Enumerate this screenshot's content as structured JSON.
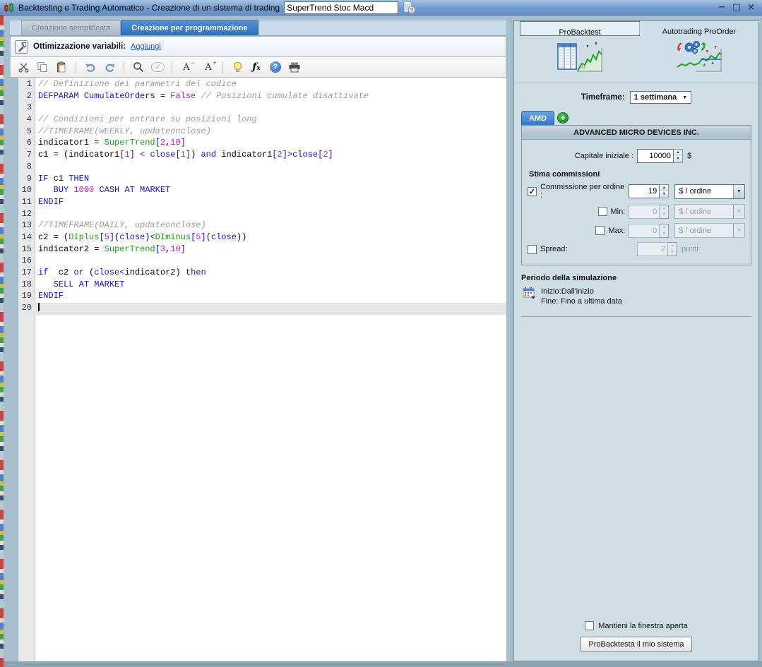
{
  "window": {
    "title": "Backtesting e Trading Automatico - Creazione di un sistema di trading",
    "system_name": "SuperTrend Stoc Macd",
    "controls": {
      "minimize": "−",
      "maximize": "□",
      "close": "×"
    }
  },
  "tabs": [
    {
      "label": "Creazione semplificata"
    },
    {
      "label": "Creazione per programmazione"
    }
  ],
  "optimization": {
    "label": "Ottimizzazione variabili:",
    "link": "Aggiungi"
  },
  "toolbar": {
    "icons": [
      "cut-icon",
      "copy-icon",
      "paste-icon",
      "undo-icon",
      "redo-icon",
      "search-icon",
      "toggle-comment-icon",
      "font-smaller-icon",
      "font-larger-icon",
      "hint-bulb-icon",
      "insert-function-icon",
      "help-icon",
      "print-icon"
    ],
    "comment_glyph": "//",
    "font_a": "A",
    "minus": "−",
    "plus": "+",
    "fx": "ƒ",
    "fx_x": "x",
    "help_q": "?"
  },
  "icons": {
    "check": "✓",
    "dropdown": "▼",
    "spin_up": "▲",
    "spin_down": "▼",
    "plus": "+",
    "help_q": "?"
  },
  "editor": {
    "lines": [
      {
        "n": 1,
        "tokens": [
          [
            "c",
            "// Definizione dei parametri del codice"
          ]
        ]
      },
      {
        "n": 2,
        "tokens": [
          [
            "k",
            "DEFPARAM"
          ],
          [
            "p",
            " "
          ],
          [
            "k",
            "CumulateOrders"
          ],
          [
            "p",
            " = "
          ],
          [
            "n",
            "False"
          ],
          [
            "p",
            " "
          ],
          [
            "c",
            "// Posizioni cumulate disattivate"
          ]
        ]
      },
      {
        "n": 3,
        "tokens": []
      },
      {
        "n": 4,
        "tokens": [
          [
            "c",
            "// Condizioni per entrare su posizioni long"
          ]
        ]
      },
      {
        "n": 5,
        "tokens": [
          [
            "c",
            "//TIMEFRAME(WEEKLY, updateonclose)"
          ]
        ]
      },
      {
        "n": 6,
        "tokens": [
          [
            "p",
            "indicator1 = "
          ],
          [
            "f",
            "SuperTrend"
          ],
          [
            "k",
            "["
          ],
          [
            "n",
            "2"
          ],
          [
            "p",
            ","
          ],
          [
            "n",
            "10"
          ],
          [
            "k",
            "]"
          ]
        ]
      },
      {
        "n": 7,
        "tokens": [
          [
            "p",
            "c1 = (indicator1"
          ],
          [
            "k",
            "["
          ],
          [
            "n",
            "1"
          ],
          [
            "k",
            "]"
          ],
          [
            "p",
            " "
          ],
          [
            "k",
            "<"
          ],
          [
            "p",
            " "
          ],
          [
            "k",
            "close"
          ],
          [
            "k",
            "["
          ],
          [
            "n",
            "1"
          ],
          [
            "k",
            "]"
          ],
          [
            "p",
            ") "
          ],
          [
            "k",
            "and"
          ],
          [
            "p",
            " indicator1"
          ],
          [
            "k",
            "["
          ],
          [
            "n",
            "2"
          ],
          [
            "k",
            "]"
          ],
          [
            "k",
            ">"
          ],
          [
            "k",
            "close"
          ],
          [
            "k",
            "["
          ],
          [
            "n",
            "2"
          ],
          [
            "k",
            "]"
          ]
        ]
      },
      {
        "n": 8,
        "tokens": []
      },
      {
        "n": 9,
        "tokens": [
          [
            "k",
            "IF"
          ],
          [
            "p",
            " c1 "
          ],
          [
            "k",
            "THEN"
          ]
        ]
      },
      {
        "n": 10,
        "tokens": [
          [
            "p",
            "   "
          ],
          [
            "k",
            "BUY"
          ],
          [
            "p",
            " "
          ],
          [
            "n",
            "1000"
          ],
          [
            "p",
            " "
          ],
          [
            "k",
            "CASH AT MARKET"
          ]
        ]
      },
      {
        "n": 11,
        "tokens": [
          [
            "k",
            "ENDIF"
          ]
        ]
      },
      {
        "n": 12,
        "tokens": []
      },
      {
        "n": 13,
        "tokens": [
          [
            "c",
            "//TIMEFRAME(DAILY, updateonclose)"
          ]
        ]
      },
      {
        "n": 14,
        "tokens": [
          [
            "p",
            "c2 = ("
          ],
          [
            "f",
            "DIplus"
          ],
          [
            "k",
            "["
          ],
          [
            "n",
            "5"
          ],
          [
            "k",
            "]"
          ],
          [
            "p",
            "("
          ],
          [
            "k",
            "close"
          ],
          [
            "p",
            ")"
          ],
          [
            "k",
            "<"
          ],
          [
            "f",
            "DIminus"
          ],
          [
            "k",
            "["
          ],
          [
            "n",
            "5"
          ],
          [
            "k",
            "]"
          ],
          [
            "p",
            "("
          ],
          [
            "k",
            "close"
          ],
          [
            "p",
            "))"
          ]
        ]
      },
      {
        "n": 15,
        "tokens": [
          [
            "p",
            "indicator2 = "
          ],
          [
            "f",
            "SuperTrend"
          ],
          [
            "k",
            "["
          ],
          [
            "n",
            "3"
          ],
          [
            "p",
            ","
          ],
          [
            "n",
            "10"
          ],
          [
            "k",
            "]"
          ]
        ]
      },
      {
        "n": 16,
        "tokens": []
      },
      {
        "n": 17,
        "tokens": [
          [
            "k",
            "if"
          ],
          [
            "p",
            "  c2 "
          ],
          [
            "k",
            "or"
          ],
          [
            "p",
            " ("
          ],
          [
            "k",
            "close"
          ],
          [
            "k",
            "<"
          ],
          [
            "p",
            "indicator2) "
          ],
          [
            "k",
            "then"
          ]
        ]
      },
      {
        "n": 18,
        "tokens": [
          [
            "p",
            "   "
          ],
          [
            "k",
            "SELL AT MARKET"
          ]
        ]
      },
      {
        "n": 19,
        "tokens": [
          [
            "k",
            "ENDIF"
          ]
        ]
      },
      {
        "n": 20,
        "tokens": [],
        "current": true,
        "caret": true
      }
    ]
  },
  "right_panel": {
    "tabs": {
      "probacktest": "ProBacktest",
      "proorder": "Autotrading ProOrder"
    },
    "timeframe": {
      "label": "Timeframe:",
      "value": "1 settimana"
    },
    "market_tab": "AMD",
    "instrument": "ADVANCED MICRO DEVICES INC.",
    "capital": {
      "label": "Capitale iniziale :",
      "value": "10000",
      "unit": "$"
    },
    "commissions": {
      "title": "Stima commissioni",
      "order": {
        "checked": true,
        "label": "Commissione per ordine :",
        "value": "19",
        "unit_options": "$ / ordine"
      },
      "min": {
        "checked": false,
        "label": "Min:",
        "value": "0",
        "unit_options": "$ / ordine"
      },
      "max": {
        "checked": false,
        "label": "Max:",
        "value": "0",
        "unit_options": "$ / ordine"
      },
      "spread": {
        "checked": false,
        "label": "Spread:",
        "value": "2",
        "unit": "punti"
      }
    },
    "periodo": {
      "title": "Periodo della simulazione",
      "inizio": "Inizio:Dall'inizio",
      "fine": "Fine: Fino a ultima data"
    },
    "keep_open_label": "Mantieni la finestra aperta",
    "keep_open_checked": false,
    "run_button": "ProBacktesta il mio sistema"
  },
  "colors": {
    "titlebar_blue": "#7099cc",
    "active_tab_blue": "#2d6fc0",
    "keyword_blue": "#1414c8",
    "function_green": "#179c17",
    "number_magenta": "#c414c8",
    "comment_gray": "#9a9a9a",
    "panel_bg": "#cfdde4",
    "amd_blue": "#3276cc",
    "plus_green": "#158515"
  }
}
